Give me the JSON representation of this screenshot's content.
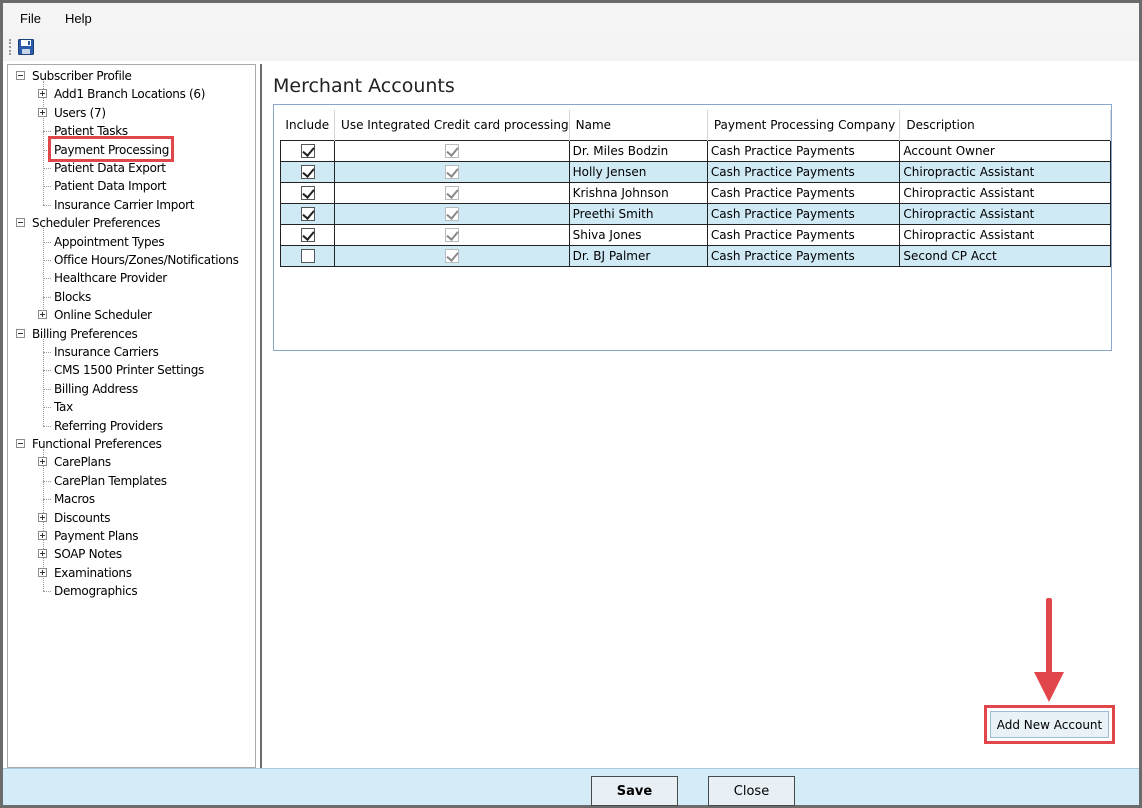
{
  "menu": {
    "file": "File",
    "help": "Help"
  },
  "tree": {
    "items": [
      {
        "label": "Subscriber Profile",
        "level": 0,
        "expander": "minus"
      },
      {
        "label": "Add1 Branch Locations (6)",
        "level": 1,
        "expander": "plus"
      },
      {
        "label": "Users (7)",
        "level": 1,
        "expander": "plus"
      },
      {
        "label": "Patient Tasks",
        "level": 1,
        "expander": "none"
      },
      {
        "label": "Payment Processing",
        "level": 1,
        "expander": "none",
        "selected": true
      },
      {
        "label": "Patient Data Export",
        "level": 1,
        "expander": "none"
      },
      {
        "label": "Patient Data Import",
        "level": 1,
        "expander": "none"
      },
      {
        "label": "Insurance Carrier Import",
        "level": 1,
        "expander": "none"
      },
      {
        "label": "Scheduler Preferences",
        "level": 0,
        "expander": "minus"
      },
      {
        "label": "Appointment Types",
        "level": 1,
        "expander": "none"
      },
      {
        "label": "Office Hours/Zones/Notifications",
        "level": 1,
        "expander": "none"
      },
      {
        "label": "Healthcare Provider",
        "level": 1,
        "expander": "none"
      },
      {
        "label": "Blocks",
        "level": 1,
        "expander": "none"
      },
      {
        "label": "Online Scheduler",
        "level": 1,
        "expander": "plus"
      },
      {
        "label": "Billing Preferences",
        "level": 0,
        "expander": "minus"
      },
      {
        "label": "Insurance Carriers",
        "level": 1,
        "expander": "none"
      },
      {
        "label": "CMS 1500 Printer Settings",
        "level": 1,
        "expander": "none"
      },
      {
        "label": "Billing Address",
        "level": 1,
        "expander": "none"
      },
      {
        "label": "Tax",
        "level": 1,
        "expander": "none"
      },
      {
        "label": "Referring Providers",
        "level": 1,
        "expander": "none"
      },
      {
        "label": "Functional Preferences",
        "level": 0,
        "expander": "minus"
      },
      {
        "label": "CarePlans",
        "level": 1,
        "expander": "plus"
      },
      {
        "label": "CarePlan Templates",
        "level": 1,
        "expander": "none"
      },
      {
        "label": "Macros",
        "level": 1,
        "expander": "none"
      },
      {
        "label": "Discounts",
        "level": 1,
        "expander": "plus"
      },
      {
        "label": "Payment Plans",
        "level": 1,
        "expander": "plus"
      },
      {
        "label": "SOAP Notes",
        "level": 1,
        "expander": "plus"
      },
      {
        "label": "Examinations",
        "level": 1,
        "expander": "plus"
      },
      {
        "label": "Demographics",
        "level": 1,
        "expander": "none"
      }
    ]
  },
  "main": {
    "title": "Merchant Accounts",
    "columns": [
      "Include",
      "Use Integrated Credit card processing",
      "Name",
      "Payment Processing Company",
      "Description"
    ],
    "rows": [
      {
        "include": true,
        "integrated": true,
        "name": "Dr. Miles Bodzin",
        "company": "Cash Practice Payments",
        "description": "Account Owner"
      },
      {
        "include": true,
        "integrated": true,
        "name": "Holly Jensen",
        "company": "Cash Practice Payments",
        "description": "Chiropractic Assistant"
      },
      {
        "include": true,
        "integrated": true,
        "name": "Krishna Johnson",
        "company": "Cash Practice Payments",
        "description": "Chiropractic Assistant"
      },
      {
        "include": true,
        "integrated": true,
        "name": "Preethi Smith",
        "company": "Cash Practice Payments",
        "description": "Chiropractic Assistant"
      },
      {
        "include": true,
        "integrated": true,
        "name": "Shiva Jones",
        "company": "Cash Practice Payments",
        "description": "Chiropractic Assistant"
      },
      {
        "include": false,
        "integrated": true,
        "name": "Dr. BJ Palmer",
        "company": "Cash Practice Payments",
        "description": "Second CP Acct"
      }
    ],
    "add_button": "Add New Account"
  },
  "footer": {
    "save": "Save",
    "close": "Close"
  },
  "colors": {
    "annotation": "#e0464a",
    "row_alt": "#cfe9f5",
    "footer_bg": "#d4ebf8"
  },
  "icons": {
    "toolbar_save": "floppy-disk-icon"
  }
}
